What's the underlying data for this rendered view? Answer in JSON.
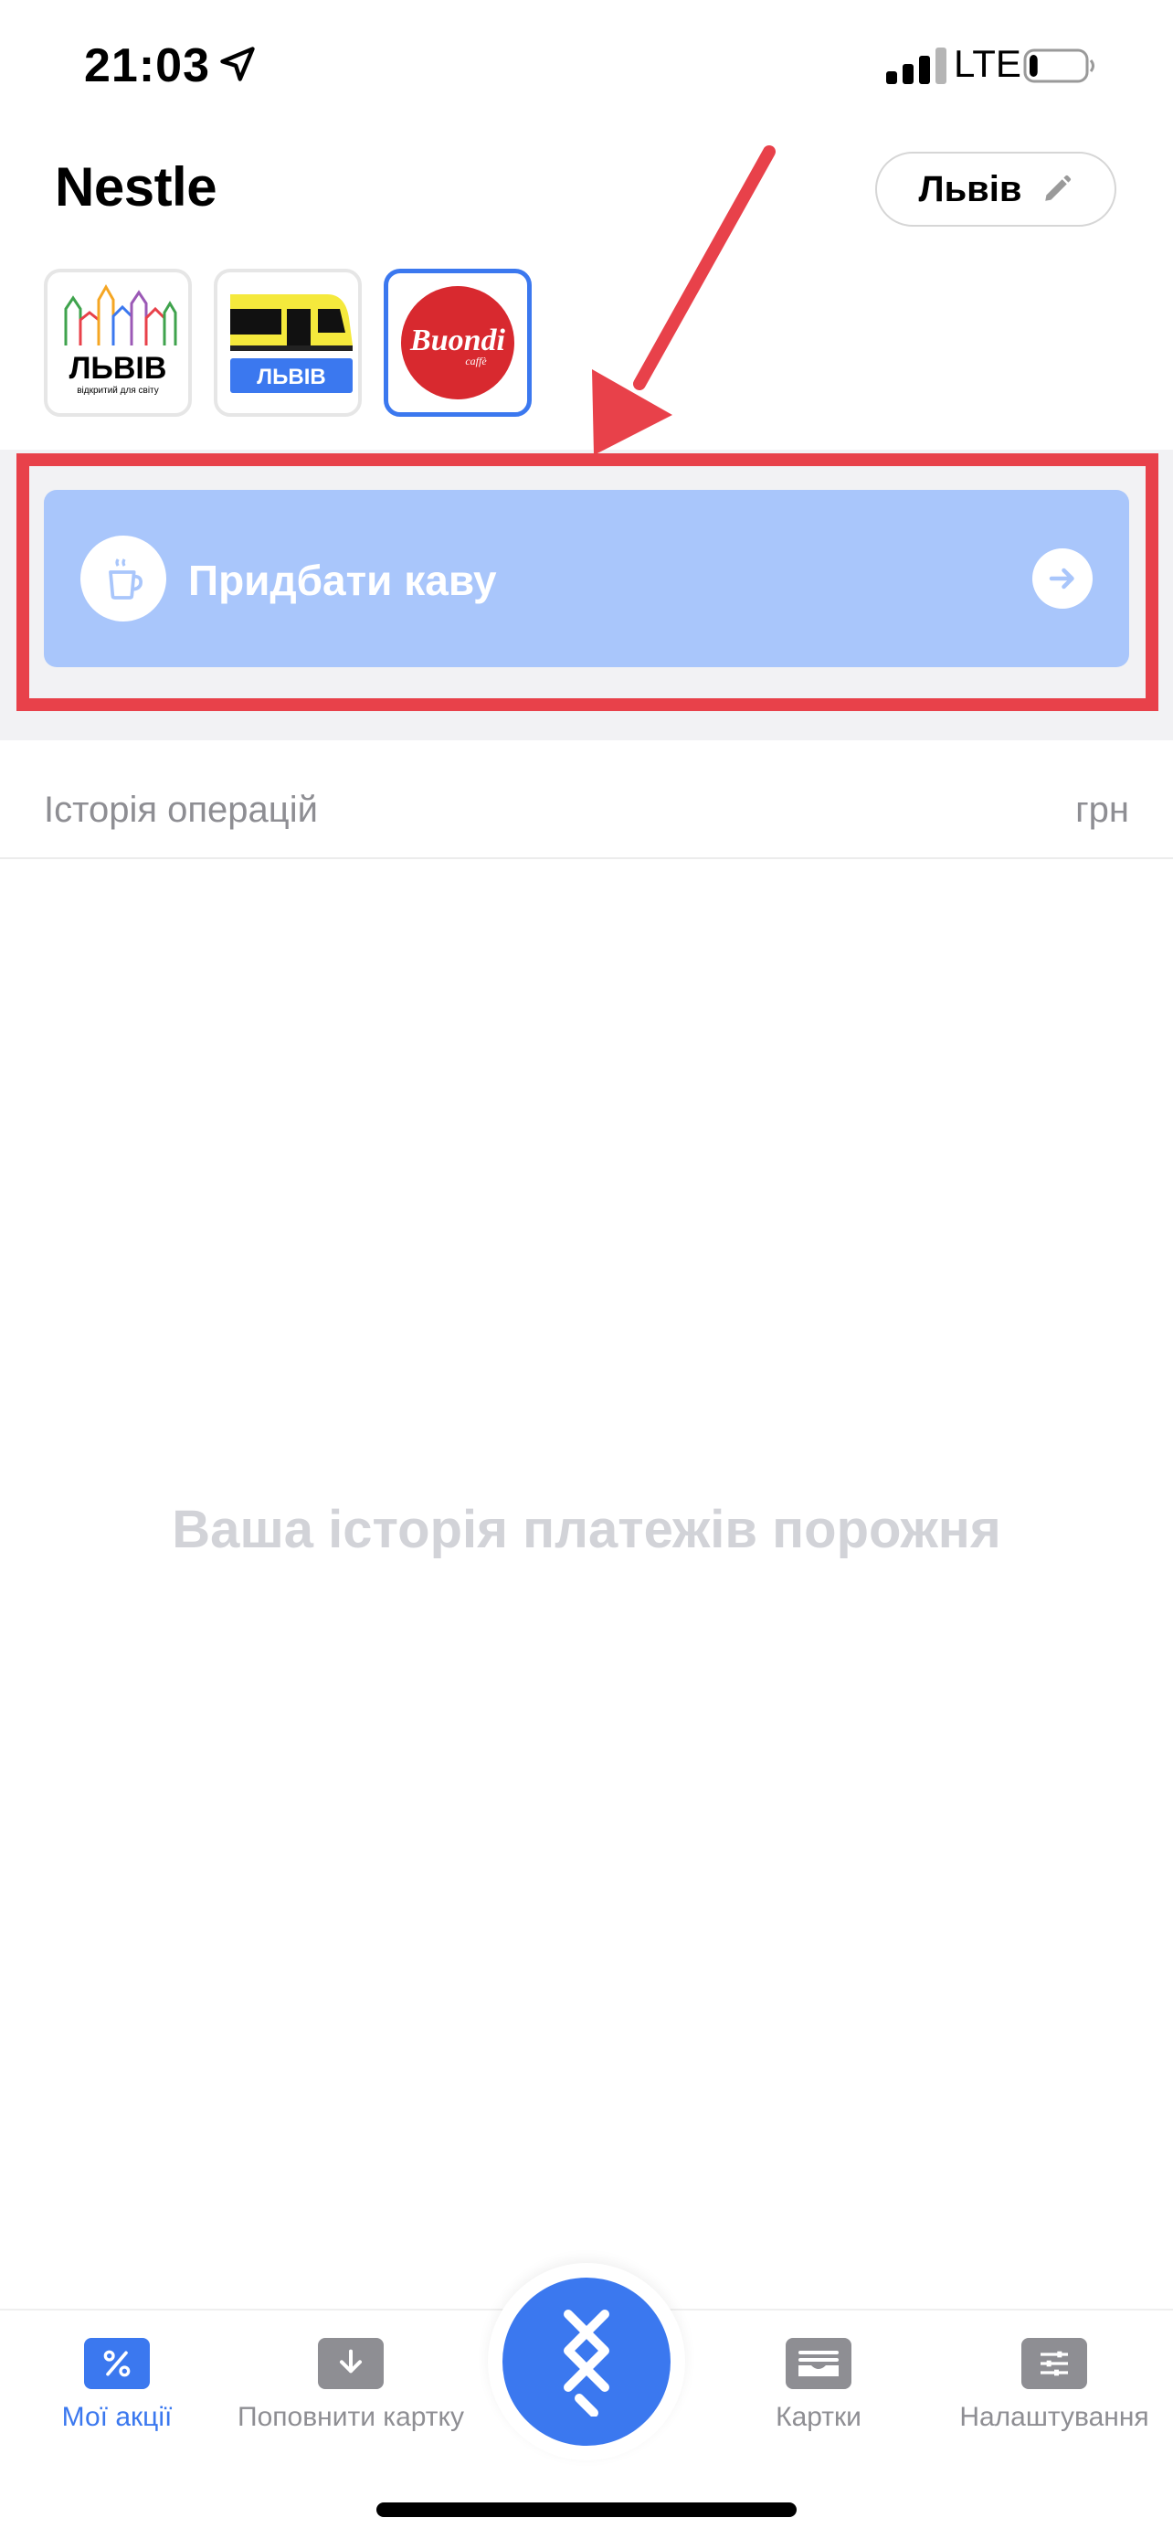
{
  "status_bar": {
    "time": "21:03",
    "network": "LTE",
    "location_icon": "location-arrow-icon",
    "signal_icon": "cellular-signal-icon",
    "battery_icon": "battery-low-icon",
    "battery_level": 0.15
  },
  "header": {
    "title": "Nestle",
    "city_button_label": "Львів",
    "edit_icon": "pencil-icon"
  },
  "cards": [
    {
      "id": "lviv",
      "label": "ЛЬВІВ",
      "sublabel": "відкритий для світу",
      "selected": false
    },
    {
      "id": "transport",
      "label": "ЛЬВІВ",
      "selected": false
    },
    {
      "id": "buondi",
      "label": "Buondi",
      "sublabel": "caffè",
      "selected": true
    }
  ],
  "promo": {
    "label": "Придбати каву",
    "icon": "coffee-cup-icon",
    "arrow_icon": "arrow-right-icon"
  },
  "history": {
    "title": "Історія операцій",
    "currency": "грн",
    "empty_message": "Ваша історія платежів порожня"
  },
  "tab_bar": {
    "tabs": [
      {
        "label": "Мої акції",
        "icon": "percent-icon",
        "active": true
      },
      {
        "label": "Поповнити картку",
        "icon": "download-arrow-icon",
        "active": false
      },
      {
        "label": "Картки",
        "icon": "wallet-cards-icon",
        "active": false
      },
      {
        "label": "Налаштування",
        "icon": "sliders-icon",
        "active": false
      }
    ],
    "center_icon": "app-logo-icon"
  },
  "colors": {
    "accent": "#3b78ef",
    "promo_bg": "#a9c6fb",
    "annotation_red": "#e8414a",
    "muted_text": "#8e8e93",
    "empty_text": "#d2d3d8"
  }
}
